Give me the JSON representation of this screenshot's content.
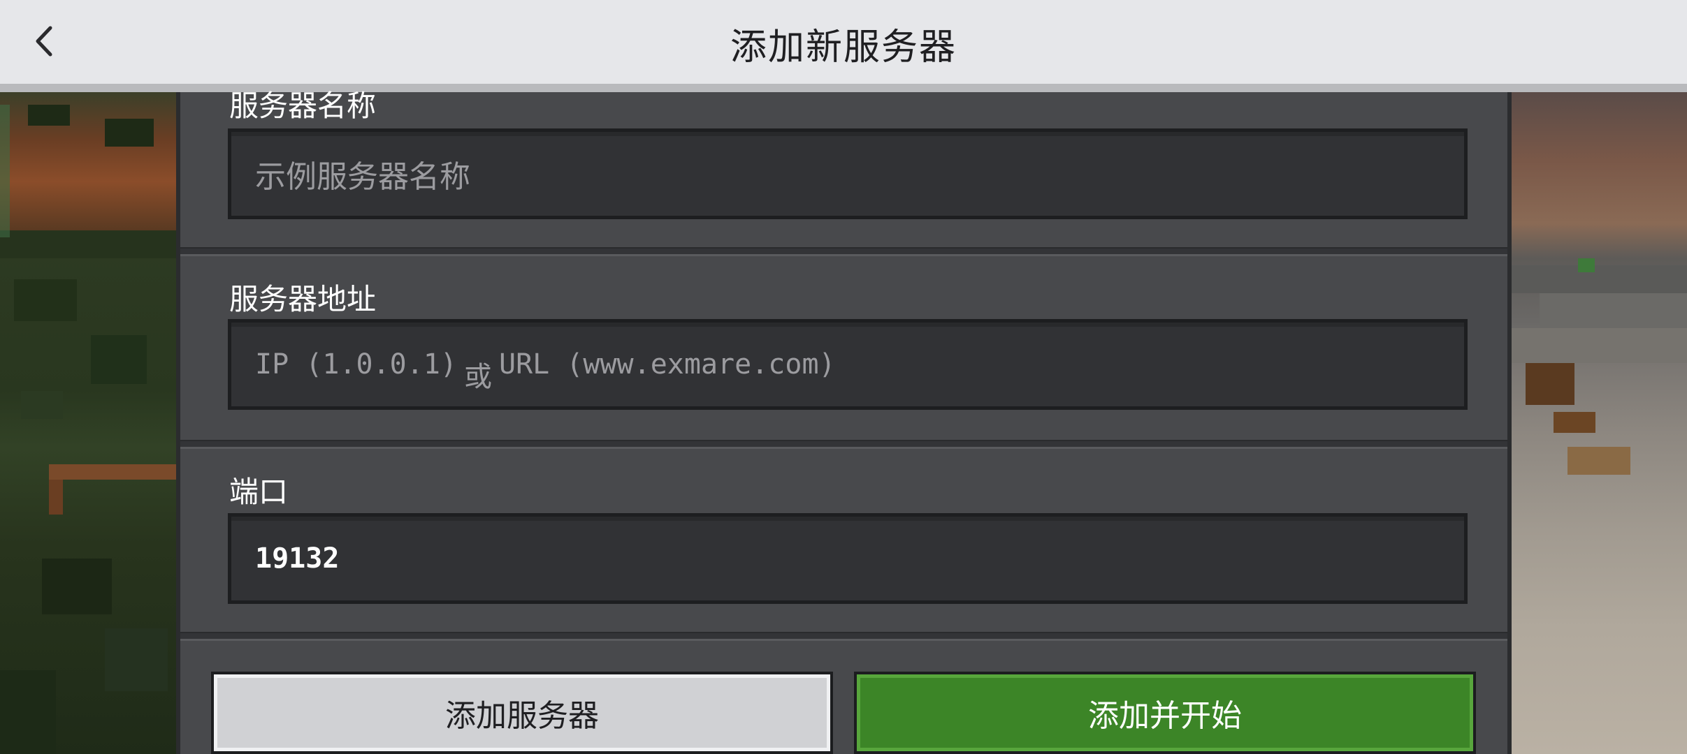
{
  "header": {
    "title": "添加新服务器",
    "back_icon": "chevron-left-icon"
  },
  "form": {
    "server_name": {
      "label": "服务器名称",
      "placeholder": "示例服务器名称",
      "value": ""
    },
    "server_address": {
      "label": "服务器地址",
      "placeholder_parts": [
        "IP (1.0.0.1)",
        "或",
        "URL (www.exmare.com)"
      ],
      "value": ""
    },
    "port": {
      "label": "端口",
      "value": "19132"
    }
  },
  "buttons": {
    "add_server": "添加服务器",
    "add_and_start": "添加并开始"
  },
  "colors": {
    "header_bg": "#e6e7ea",
    "panel_bg": "#48494c",
    "input_bg": "#313235",
    "primary_button": "#3c8527",
    "secondary_button": "#d0d1d4"
  }
}
